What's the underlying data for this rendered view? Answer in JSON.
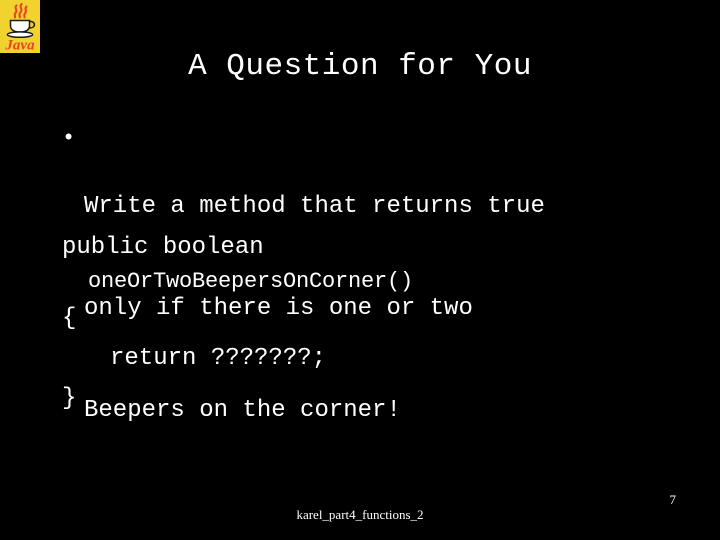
{
  "slide": {
    "background_color": "#000000",
    "text_color": "#ffffff",
    "title": "A Question for You"
  },
  "logo": {
    "name": "java-logo",
    "wordmark": "Java",
    "background_color": "#f2d22e",
    "mark_color": "#e8442a",
    "cup_color": "#1a1a1a"
  },
  "bullets": [
    {
      "marker": "•",
      "lines": [
        "Write a method that returns true",
        "only if there is one or two",
        "Beepers on the corner!"
      ]
    }
  ],
  "code": {
    "lines": [
      "public boolean",
      "oneOrTwoBeepersOnCorner()",
      "{",
      "return ???????;",
      "}"
    ],
    "declaration": "public boolean",
    "signature": "oneOrTwoBeepersOnCorner()",
    "open_brace": "{",
    "return_statement": "return ???????;",
    "close_brace": "}"
  },
  "footer": {
    "note": "karel_part4_functions_2",
    "page_number": "7"
  }
}
